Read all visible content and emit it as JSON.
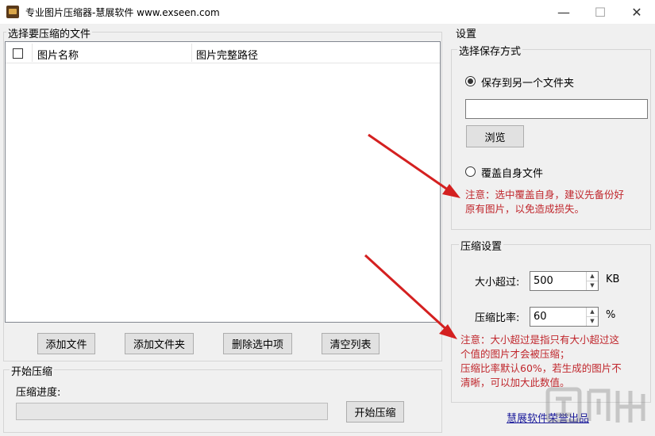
{
  "window": {
    "title": "专业图片压缩器-慧展软件 www.exseen.com",
    "minimize_glyph": "—",
    "maximize_glyph": "☐",
    "close_glyph": "✕"
  },
  "file_panel": {
    "label": "选择要压缩的文件",
    "columns": [
      "图片名称",
      "图片完整路径"
    ],
    "buttons": {
      "add_file": "添加文件",
      "add_folder": "添加文件夹",
      "delete_selected": "删除选中项",
      "clear_list": "清空列表"
    }
  },
  "compress_panel": {
    "label": "开始压缩",
    "progress_label": "压缩进度:",
    "progress": 0,
    "start_button": "开始压缩"
  },
  "settings": {
    "label": "设置",
    "save_mode": {
      "label": "选择保存方式",
      "option_other_folder": "保存到另一个文件夹",
      "folder_path": "",
      "browse_button": "浏览",
      "option_overwrite": "覆盖自身文件",
      "selected": "other_folder",
      "note_line1": "注意：选中覆盖自身，建议先备份好",
      "note_line2": "原有图片，以免造成损失。"
    },
    "compress_settings": {
      "label": "压缩设置",
      "size_label": "大小超过:",
      "size_value": "500",
      "size_unit": "KB",
      "ratio_label": "压缩比率:",
      "ratio_value": "60",
      "ratio_unit": "%",
      "note_line1": "注意：大小超过是指只有大小超过这",
      "note_line2": "个值的图片才会被压缩；",
      "note_line3": "压缩比率默认60%，若生成的图片不",
      "note_line4": "清晰，可以加大此数值。"
    },
    "footer_link": "慧展软件荣誉出品"
  },
  "colors": {
    "note_red": "#c0272d",
    "arrow_red": "#d42020",
    "link_blue": "#1a1a9a"
  },
  "icons": {
    "app": "app-icon",
    "spin_up": "▲",
    "spin_down": "▼"
  }
}
